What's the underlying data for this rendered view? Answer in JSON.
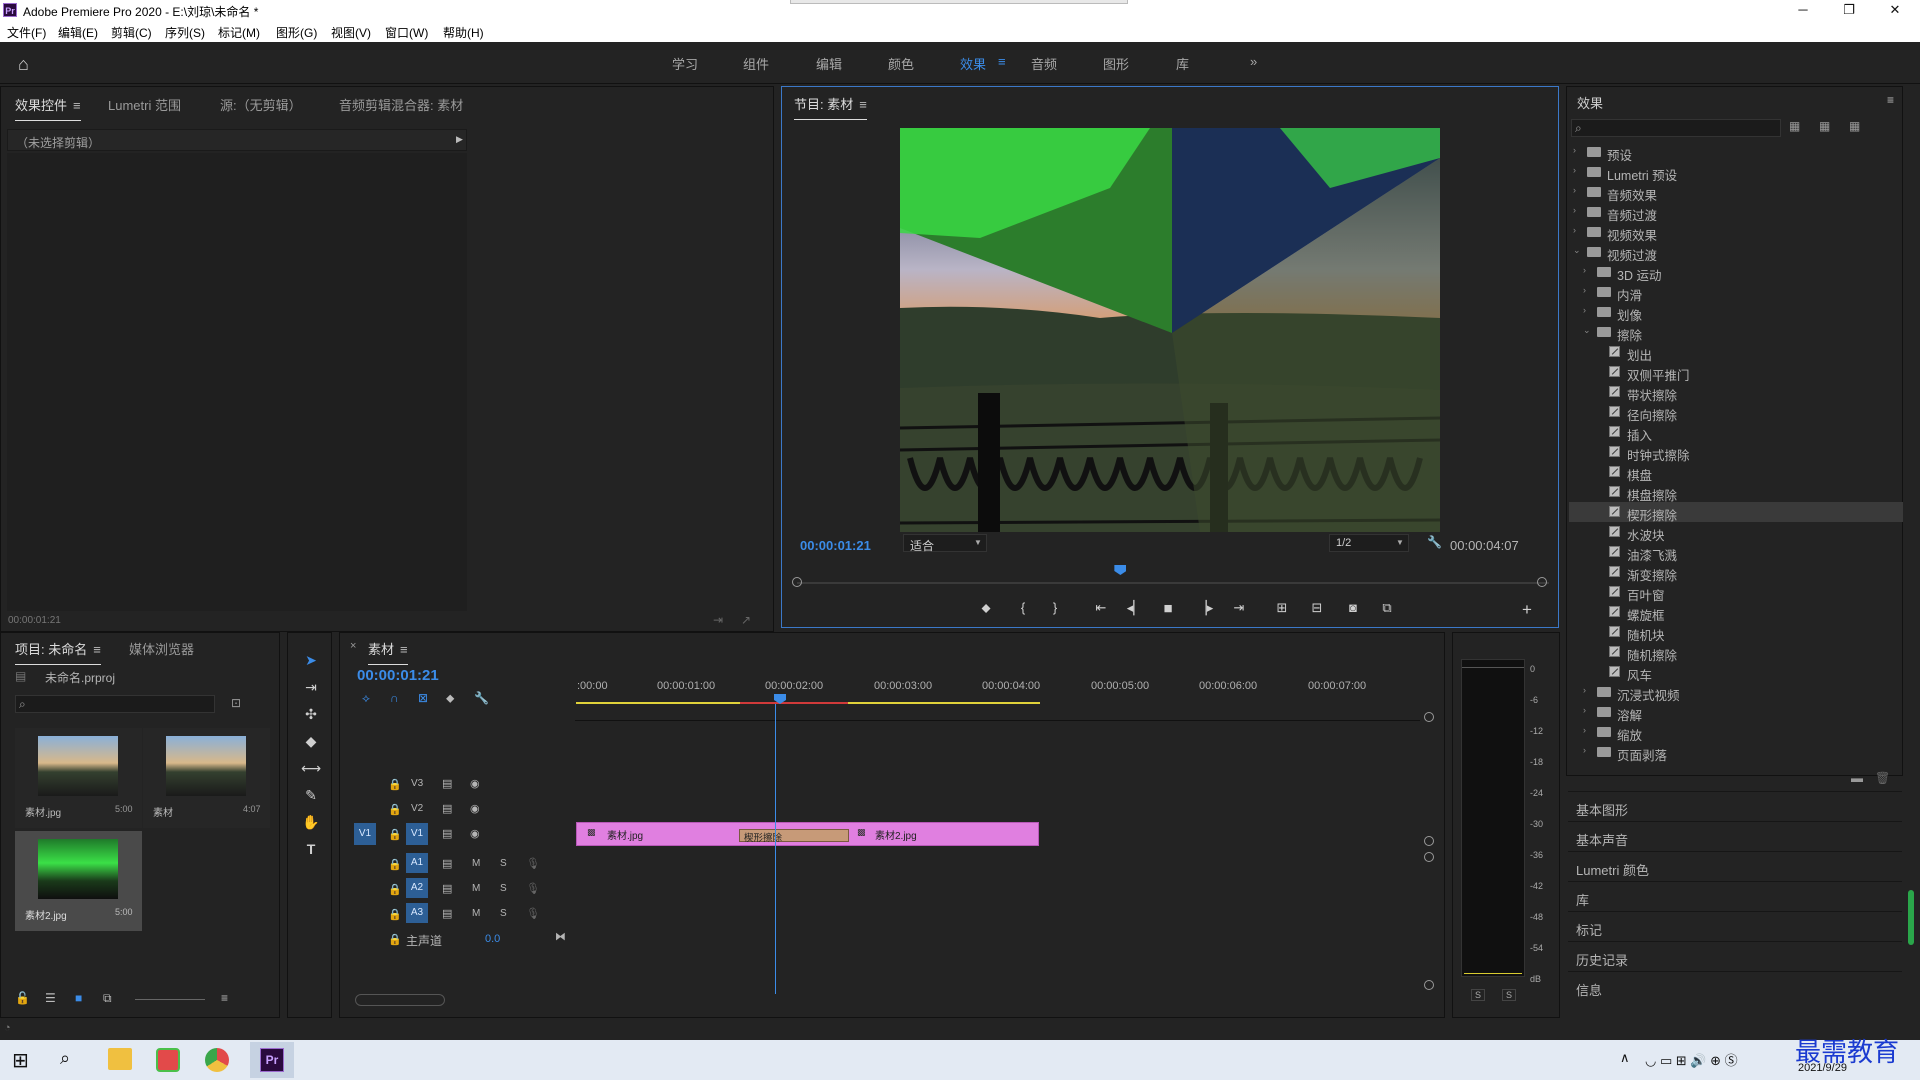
{
  "app": {
    "title": "Adobe Premiere Pro 2020 - E:\\刘琼\\未命名 *",
    "logo": "Pr"
  },
  "menu": [
    "文件(F)",
    "编辑(E)",
    "剪辑(C)",
    "序列(S)",
    "标记(M)",
    "图形(G)",
    "视图(V)",
    "窗口(W)",
    "帮助(H)"
  ],
  "workspaces": [
    "学习",
    "组件",
    "编辑",
    "颜色",
    "效果",
    "音频",
    "图形",
    "库"
  ],
  "active_workspace": "效果",
  "effect_controls": {
    "tabs": [
      "效果控件",
      "Lumetri 范围",
      "源:（无剪辑）",
      "音频剪辑混合器: 素材"
    ],
    "no_clip": "（未选择剪辑）",
    "timecode": "00:00:01:21"
  },
  "program": {
    "title": "节目: 素材",
    "timecode": "00:00:01:21",
    "fit": "适合",
    "quality": "1/2",
    "duration": "00:00:04:07",
    "playhead_fraction": 0.43
  },
  "effects": {
    "title": "效果",
    "tree": [
      {
        "label": "预设",
        "level": 0,
        "type": "folder",
        "open": false
      },
      {
        "label": "Lumetri 预设",
        "level": 0,
        "type": "folder",
        "open": false
      },
      {
        "label": "音频效果",
        "level": 0,
        "type": "folder",
        "open": false
      },
      {
        "label": "音频过渡",
        "level": 0,
        "type": "folder",
        "open": false
      },
      {
        "label": "视频效果",
        "level": 0,
        "type": "folder",
        "open": false
      },
      {
        "label": "视频过渡",
        "level": 0,
        "type": "folder",
        "open": true
      },
      {
        "label": "3D 运动",
        "level": 1,
        "type": "folder",
        "open": false
      },
      {
        "label": "内滑",
        "level": 1,
        "type": "folder",
        "open": false
      },
      {
        "label": "划像",
        "level": 1,
        "type": "folder",
        "open": false
      },
      {
        "label": "擦除",
        "level": 1,
        "type": "folder",
        "open": true
      },
      {
        "label": "划出",
        "level": 2,
        "type": "fx"
      },
      {
        "label": "双侧平推门",
        "level": 2,
        "type": "fx"
      },
      {
        "label": "带状擦除",
        "level": 2,
        "type": "fx"
      },
      {
        "label": "径向擦除",
        "level": 2,
        "type": "fx"
      },
      {
        "label": "插入",
        "level": 2,
        "type": "fx"
      },
      {
        "label": "时钟式擦除",
        "level": 2,
        "type": "fx"
      },
      {
        "label": "棋盘",
        "level": 2,
        "type": "fx"
      },
      {
        "label": "棋盘擦除",
        "level": 2,
        "type": "fx"
      },
      {
        "label": "楔形擦除",
        "level": 2,
        "type": "fx",
        "selected": true
      },
      {
        "label": "水波块",
        "level": 2,
        "type": "fx"
      },
      {
        "label": "油漆飞溅",
        "level": 2,
        "type": "fx"
      },
      {
        "label": "渐变擦除",
        "level": 2,
        "type": "fx"
      },
      {
        "label": "百叶窗",
        "level": 2,
        "type": "fx"
      },
      {
        "label": "螺旋框",
        "level": 2,
        "type": "fx"
      },
      {
        "label": "随机块",
        "level": 2,
        "type": "fx"
      },
      {
        "label": "随机擦除",
        "level": 2,
        "type": "fx"
      },
      {
        "label": "风车",
        "level": 2,
        "type": "fx"
      },
      {
        "label": "沉浸式视频",
        "level": 1,
        "type": "folder",
        "open": false
      },
      {
        "label": "溶解",
        "level": 1,
        "type": "folder",
        "open": false
      },
      {
        "label": "缩放",
        "level": 1,
        "type": "folder",
        "open": false
      },
      {
        "label": "页面剥落",
        "level": 1,
        "type": "folder",
        "open": false
      }
    ],
    "side_panels": [
      "基本图形",
      "基本声音",
      "Lumetri 颜色",
      "库",
      "标记",
      "历史记录",
      "信息"
    ]
  },
  "project": {
    "tabs": [
      "项目: 未命名",
      "媒体浏览器"
    ],
    "file": "未命名.prproj",
    "items": [
      {
        "name": "素材.jpg",
        "dur": "5:00"
      },
      {
        "name": "素材",
        "dur": "4:07"
      },
      {
        "name": "素材2.jpg",
        "dur": "5:00"
      }
    ]
  },
  "timeline": {
    "tab": "素材",
    "timecode": "00:00:01:21",
    "ruler": [
      ":00:00",
      "00:00:01:00",
      "00:00:02:00",
      "00:00:03:00",
      "00:00:04:00",
      "00:00:05:00",
      "00:00:06:00",
      "00:00:07:00"
    ],
    "tracks_v": [
      "V3",
      "V2",
      "V1"
    ],
    "tracks_a": [
      "A1",
      "A2",
      "A3"
    ],
    "master": "主声道",
    "master_val": "0.0",
    "clips": [
      {
        "name": "素材.jpg"
      },
      {
        "name": "素材2.jpg"
      }
    ],
    "transition": "楔形擦除"
  },
  "meter": {
    "scale": [
      "0",
      "-6",
      "-12",
      "-18",
      "-24",
      "-30",
      "-36",
      "-42",
      "-48",
      "-54",
      "dB"
    ],
    "solo": [
      "S",
      "S"
    ]
  },
  "taskbar": {
    "date": "2021/9/29",
    "watermark": "最需教育"
  }
}
